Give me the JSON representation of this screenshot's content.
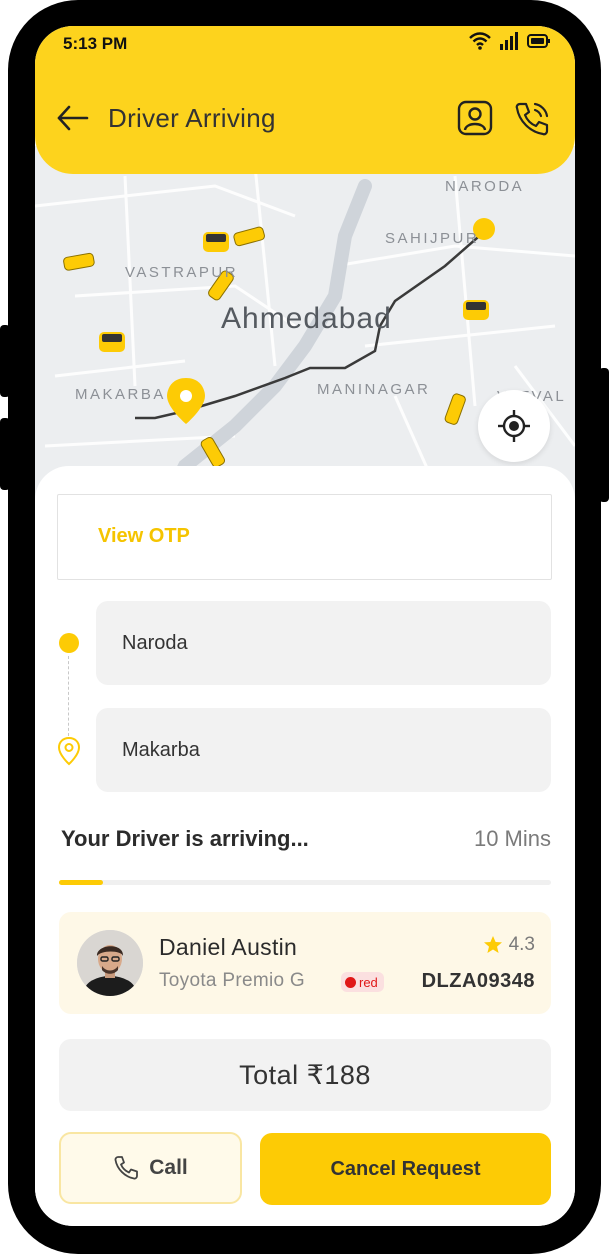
{
  "status_bar": {
    "time": "5:13 PM"
  },
  "header": {
    "title": "Driver Arriving"
  },
  "map": {
    "labels": {
      "naroda": "NARODA",
      "sahijpur": "SAHIJPUR",
      "vastrapur": "VASTRAPUR",
      "makarba": "MAKARBA",
      "maninagar": "MANINAGAR",
      "vatva": "VATVAL"
    },
    "city": "Ahmedabad"
  },
  "otp": {
    "link_label": "View OTP"
  },
  "route": {
    "pickup": "Naroda",
    "drop": "Makarba"
  },
  "arrival": {
    "status_text": "Your Driver is arriving...",
    "eta": "10 Mins",
    "progress_fraction": 0.09
  },
  "driver": {
    "name": "Daniel Austin",
    "rating": "4.3",
    "car_model": "Toyota Premio G",
    "car_color": "red",
    "plate": "DLZA09348"
  },
  "fare": {
    "total_label": "Total ₹188"
  },
  "actions": {
    "call_label": "Call",
    "cancel_label": "Cancel Request"
  },
  "colors": {
    "accent": "#FDCB05",
    "header_bg": "#FDD31D",
    "car_color_badge": "#e01818"
  },
  "icons": [
    "back-arrow-icon",
    "profile-icon",
    "phone-call-icon",
    "wifi-icon",
    "signal-icon",
    "battery-icon",
    "locate-icon",
    "star-icon",
    "phone-icon",
    "location-pin-icon",
    "taxi-icon",
    "auto-rickshaw-icon"
  ]
}
